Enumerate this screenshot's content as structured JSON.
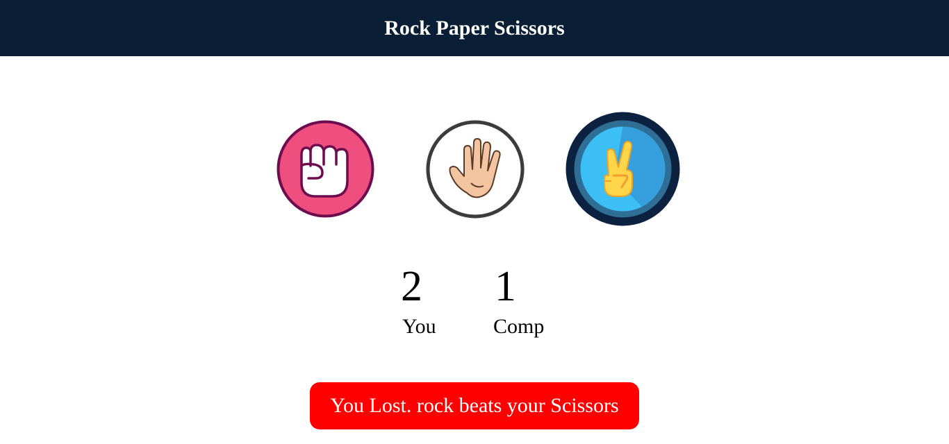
{
  "header": {
    "title": "Rock Paper Scissors"
  },
  "choices": [
    {
      "id": "rock",
      "icon": "fist-icon"
    },
    {
      "id": "paper",
      "icon": "open-hand-icon"
    },
    {
      "id": "scissors",
      "icon": "peace-hand-icon"
    }
  ],
  "scoreboard": {
    "user": {
      "score": "2",
      "label": "You"
    },
    "comp": {
      "score": "1",
      "label": "Comp"
    }
  },
  "result": {
    "message": "You Lost. rock beats your Scissors",
    "color": "#ff0000"
  },
  "colors": {
    "header_bg": "#0a1e35",
    "rock_bg": "#ef4f7e",
    "rock_border": "#6d0c4f",
    "paper_border": "#3b3b3b",
    "scissors_outer": "#0c2240",
    "scissors_inner": "#3cbff4"
  }
}
